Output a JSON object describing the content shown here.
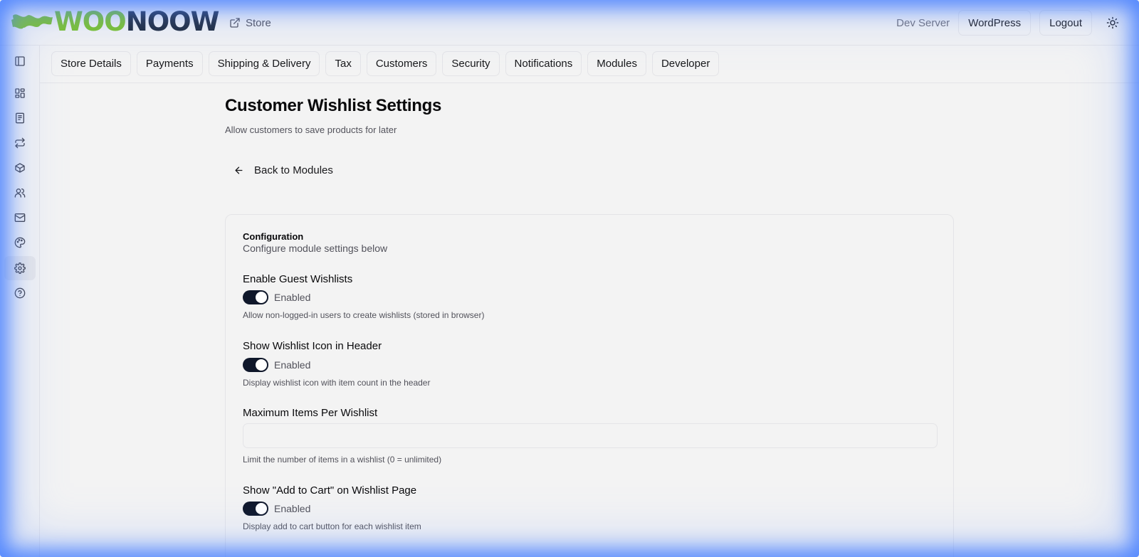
{
  "header": {
    "logo_woo": "WOO",
    "logo_now": "NOOW",
    "store_link": "Store",
    "dev_label": "Dev Server",
    "wordpress_button": "WordPress",
    "logout_button": "Logout"
  },
  "sidebar": {
    "items": [
      {
        "icon": "panel-toggle-icon"
      },
      {
        "icon": "dashboard-icon"
      },
      {
        "icon": "orders-icon"
      },
      {
        "icon": "transfer-icon"
      },
      {
        "icon": "package-icon"
      },
      {
        "icon": "users-icon"
      },
      {
        "icon": "mail-icon"
      },
      {
        "icon": "palette-icon"
      },
      {
        "icon": "gear-icon",
        "active": true
      },
      {
        "icon": "help-icon"
      }
    ]
  },
  "tabs": [
    "Store Details",
    "Payments",
    "Shipping & Delivery",
    "Tax",
    "Customers",
    "Security",
    "Notifications",
    "Modules",
    "Developer"
  ],
  "page": {
    "title": "Customer Wishlist Settings",
    "subtitle": "Allow customers to save products for later",
    "back_label": "Back to Modules"
  },
  "card": {
    "title": "Configuration",
    "subtitle": "Configure module settings below",
    "fields": {
      "guest": {
        "label": "Enable Guest Wishlists",
        "state": "Enabled",
        "help": "Allow non-logged-in users to create wishlists (stored in browser)"
      },
      "header_icon": {
        "label": "Show Wishlist Icon in Header",
        "state": "Enabled",
        "help": "Display wishlist icon with item count in the header"
      },
      "max_items": {
        "label": "Maximum Items Per Wishlist",
        "value": "",
        "help": "Limit the number of items in a wishlist (0 = unlimited)"
      },
      "add_to_cart": {
        "label": "Show \"Add to Cart\" on Wishlist Page",
        "state": "Enabled",
        "help": "Display add to cart button for each wishlist item"
      }
    }
  },
  "colors": {
    "brand_green": "#7bc22a",
    "brand_dark": "#1e293b",
    "switch_on": "#0f172a"
  }
}
